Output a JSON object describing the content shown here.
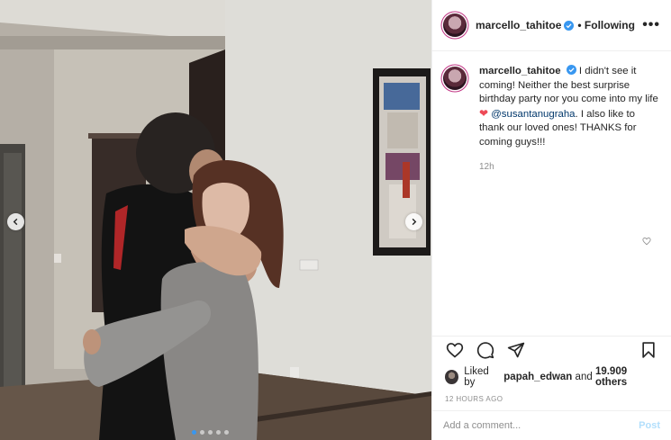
{
  "post": {
    "username": "marcello_tahitoe",
    "follow_state": "• Following",
    "more_label": "•••",
    "caption_text_1": "I didn't see it coming! Neither the best surprise birthday party nor you come into my life",
    "caption_heart": "❤",
    "caption_mention": "@susantanugraha",
    "caption_text_2": ". I also like to thank our loved ones! THANKS for coming guys!!!",
    "caption_age": "12h",
    "liked_prefix": "Liked by",
    "liked_by_user": "papah_edwan",
    "liked_and": "and",
    "liked_count": "19.909 others",
    "posted_ago": "12 HOURS AGO",
    "comment_placeholder": "Add a comment...",
    "post_label": "Post"
  },
  "carousel": {
    "total_slides": 5,
    "active_slide": 1
  },
  "icons": {
    "header_avatar": "avatar",
    "verified": "verified-badge-icon",
    "like": "heart-icon",
    "comment": "comment-icon",
    "share": "paper-plane-icon",
    "save": "bookmark-icon",
    "prev": "chevron-left-icon",
    "next": "chevron-right-icon"
  },
  "colors": {
    "verified_blue": "#3897f0",
    "mention": "#00376b",
    "heart": "#ed4956",
    "post_disabled": "#b2dffc"
  }
}
